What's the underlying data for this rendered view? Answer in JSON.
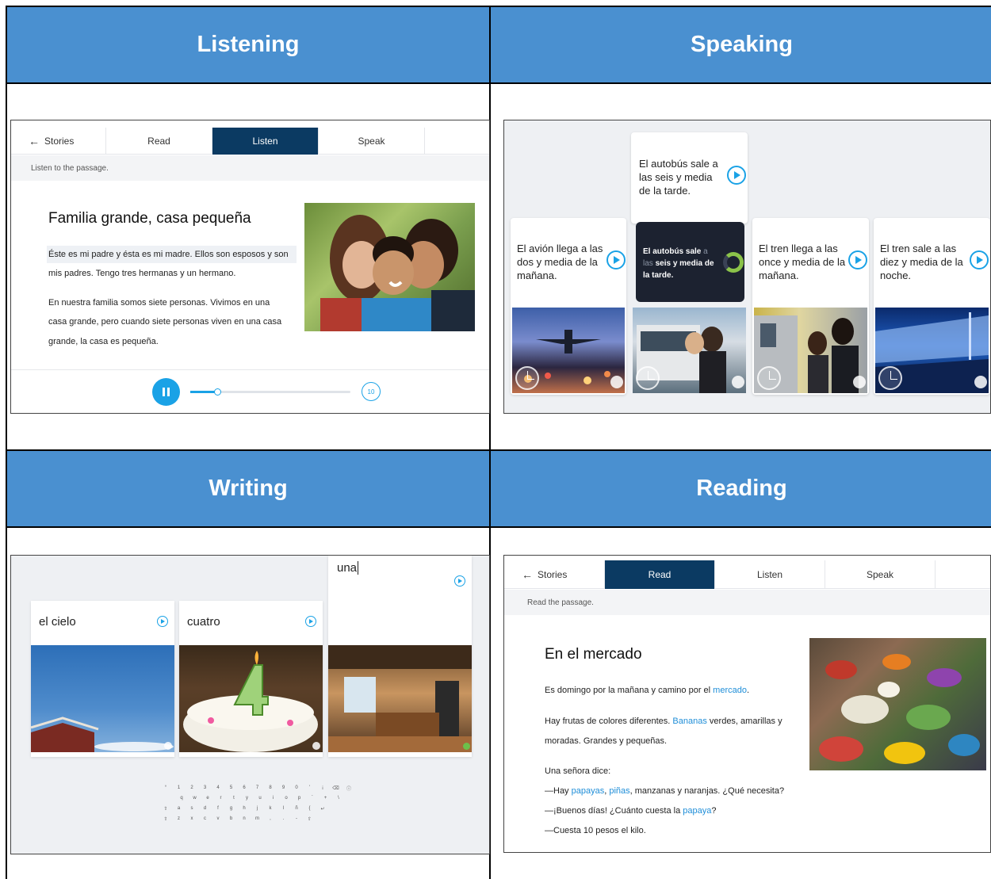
{
  "panels": {
    "listening": "Listening",
    "speaking": "Speaking",
    "writing": "Writing",
    "reading": "Reading"
  },
  "listen_app": {
    "tabs": {
      "back": "Stories",
      "read": "Read",
      "listen": "Listen",
      "speak": "Speak"
    },
    "instruction": "Listen to the passage.",
    "title": "Familia grande, casa pequeña",
    "lines": [
      "Éste es mi padre y ésta es mi madre. Ellos son esposos y son",
      "mis padres. Tengo tres hermanas y un hermano.",
      "En nuestra familia somos siete personas. Vivimos en una",
      "casa grande, pero cuando siete personas viven en una casa",
      "grande, la casa es pequeña."
    ],
    "rewind_label": "10",
    "progress": 0.17
  },
  "speak_app": {
    "cards": [
      "El avión llega a las dos y media de la mañana.",
      "El autobús sale a las seis y media de la tarde.",
      "El tren llega a las once y media de la mañana.",
      "El tren sale a las diez y media de la noche."
    ],
    "recording": {
      "part1": "El autobús sale ",
      "part2": "a",
      "part3": "las",
      "part4": " seis y media de",
      "part5": "la tarde."
    }
  },
  "write_app": {
    "cards": [
      "el cielo",
      "cuatro"
    ],
    "typed": "una",
    "keyboard": {
      "row1": [
        "°",
        "1",
        "2",
        "3",
        "4",
        "5",
        "6",
        "7",
        "8",
        "9",
        "0",
        "'",
        "¡",
        "⌫",
        "ⓘ"
      ],
      "row2": [
        "q",
        "w",
        "e",
        "r",
        "t",
        "y",
        "u",
        "i",
        "o",
        "p",
        "´",
        "+",
        "\\"
      ],
      "row3": [
        "⇧",
        "a",
        "s",
        "d",
        "f",
        "g",
        "h",
        "j",
        "k",
        "l",
        "ñ",
        "{",
        "↵"
      ],
      "row4": [
        "⇧",
        "z",
        "x",
        "c",
        "v",
        "b",
        "n",
        "m",
        ",",
        ".",
        "-",
        "⇧"
      ]
    }
  },
  "read_app": {
    "tabs": {
      "back": "Stories",
      "read": "Read",
      "listen": "Listen",
      "speak": "Speak"
    },
    "instruction": "Read the passage.",
    "title": "En el mercado",
    "p1a": "Es domingo por la mañana y camino por el ",
    "p1link": "mercado",
    "p1b": ".",
    "p2a": "Hay frutas de colores diferentes. ",
    "p2link": "Bananas",
    "p2b": " verdes, amarillas y",
    "p3": "moradas. Grandes y pequeñas.",
    "p4": "Una señora dice:",
    "p5a": "—Hay ",
    "p5l1": "papayas",
    "p5s1": ", ",
    "p5l2": "piñas",
    "p5b": ", manzanas y naranjas. ¿Qué necesita?",
    "p6a": "—¡Buenos días! ¿Cuánto cuesta la ",
    "p6link": "papaya",
    "p6b": "?",
    "p7": "—Cuesta 10 pesos el kilo."
  }
}
